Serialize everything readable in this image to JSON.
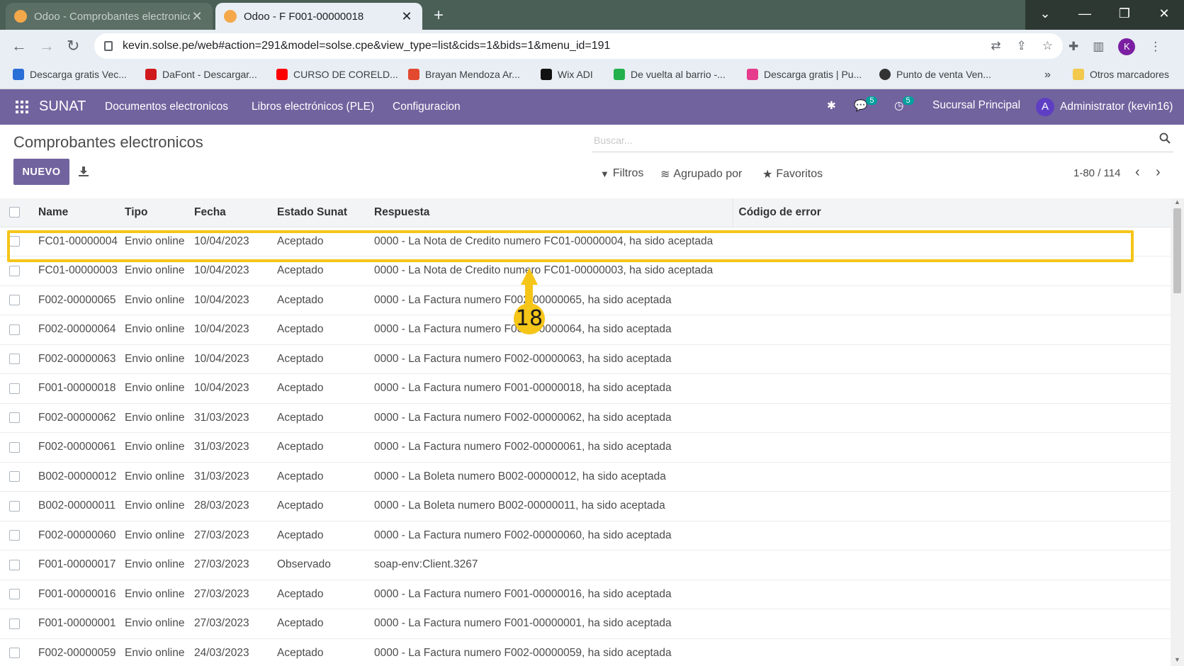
{
  "browser": {
    "tabs": [
      {
        "title": "Odoo - Comprobantes electronicos"
      },
      {
        "title": "Odoo - F F001-00000018"
      }
    ],
    "url": "kevin.solse.pe/web#action=291&model=solse.cpe&view_type=list&cids=1&bids=1&menu_id=191",
    "profile_initial": "K",
    "bookmarks": [
      {
        "label": "Descarga gratis Vec...",
        "color": "#2a6ed8"
      },
      {
        "label": "DaFont - Descargar...",
        "color": "#d0191d"
      },
      {
        "label": "CURSO DE CORELD...",
        "color": "#ff0000"
      },
      {
        "label": "Brayan Mendoza Ar...",
        "color": "#e2492f"
      },
      {
        "label": "Wix ADI",
        "color": "#111111"
      },
      {
        "label": "De vuelta al barrio -...",
        "color": "#22b14c"
      },
      {
        "label": "Descarga gratis | Pu...",
        "color": "#e63a8c"
      },
      {
        "label": "Punto de venta Ven...",
        "color": "#333333"
      }
    ],
    "bookmarks_more": "»",
    "other_bookmarks": "Otros marcadores"
  },
  "nav": {
    "brand": "SUNAT",
    "menu": [
      "Documentos electronicos",
      "Libros electrónicos (PLE)",
      "Configuracion"
    ],
    "messages_count": "5",
    "activities_count": "5",
    "company": "Sucursal Principal",
    "user_initial": "A",
    "user": "Administrator (kevin16)"
  },
  "page": {
    "breadcrumb": "Comprobantes electronicos",
    "search_placeholder": "Buscar...",
    "new_button": "NUEVO",
    "filters": "Filtros",
    "group_by": "Agrupado por",
    "favorites": "Favoritos",
    "pager": "1-80 / 114"
  },
  "table": {
    "headers": {
      "name": "Name",
      "tipo": "Tipo",
      "fecha": "Fecha",
      "estado": "Estado Sunat",
      "respuesta": "Respuesta",
      "error": "Código de error"
    },
    "rows": [
      {
        "name": "FC01-00000004",
        "tipo": "Envio online",
        "fecha": "10/04/2023",
        "estado": "Aceptado",
        "respuesta": "0000 - La Nota de Credito numero FC01-00000004, ha sido aceptada",
        "error": ""
      },
      {
        "name": "FC01-00000003",
        "tipo": "Envio online",
        "fecha": "10/04/2023",
        "estado": "Aceptado",
        "respuesta": "0000 - La Nota de Credito numero FC01-00000003, ha sido aceptada",
        "error": ""
      },
      {
        "name": "F002-00000065",
        "tipo": "Envio online",
        "fecha": "10/04/2023",
        "estado": "Aceptado",
        "respuesta": "0000 - La Factura numero F002-00000065, ha sido aceptada",
        "error": ""
      },
      {
        "name": "F002-00000064",
        "tipo": "Envio online",
        "fecha": "10/04/2023",
        "estado": "Aceptado",
        "respuesta": "0000 - La Factura numero F002-00000064, ha sido aceptada",
        "error": ""
      },
      {
        "name": "F002-00000063",
        "tipo": "Envio online",
        "fecha": "10/04/2023",
        "estado": "Aceptado",
        "respuesta": "0000 - La Factura numero F002-00000063, ha sido aceptada",
        "error": ""
      },
      {
        "name": "F001-00000018",
        "tipo": "Envio online",
        "fecha": "10/04/2023",
        "estado": "Aceptado",
        "respuesta": "0000 - La Factura numero F001-00000018, ha sido aceptada",
        "error": ""
      },
      {
        "name": "F002-00000062",
        "tipo": "Envio online",
        "fecha": "31/03/2023",
        "estado": "Aceptado",
        "respuesta": "0000 - La Factura numero F002-00000062, ha sido aceptada",
        "error": ""
      },
      {
        "name": "F002-00000061",
        "tipo": "Envio online",
        "fecha": "31/03/2023",
        "estado": "Aceptado",
        "respuesta": "0000 - La Factura numero F002-00000061, ha sido aceptada",
        "error": ""
      },
      {
        "name": "B002-00000012",
        "tipo": "Envio online",
        "fecha": "31/03/2023",
        "estado": "Aceptado",
        "respuesta": "0000 - La Boleta numero B002-00000012, ha sido aceptada",
        "error": ""
      },
      {
        "name": "B002-00000011",
        "tipo": "Envio online",
        "fecha": "28/03/2023",
        "estado": "Aceptado",
        "respuesta": "0000 - La Boleta numero B002-00000011, ha sido aceptada",
        "error": ""
      },
      {
        "name": "F002-00000060",
        "tipo": "Envio online",
        "fecha": "27/03/2023",
        "estado": "Aceptado",
        "respuesta": "0000 - La Factura numero F002-00000060, ha sido aceptada",
        "error": ""
      },
      {
        "name": "F001-00000017",
        "tipo": "Envio online",
        "fecha": "27/03/2023",
        "estado": "Observado",
        "respuesta": "soap-env:Client.3267",
        "error": ""
      },
      {
        "name": "F001-00000016",
        "tipo": "Envio online",
        "fecha": "27/03/2023",
        "estado": "Aceptado",
        "respuesta": "0000 - La Factura numero F001-00000016, ha sido aceptada",
        "error": ""
      },
      {
        "name": "F001-00000001",
        "tipo": "Envio online",
        "fecha": "27/03/2023",
        "estado": "Aceptado",
        "respuesta": "0000 - La Factura numero F001-00000001, ha sido aceptada",
        "error": ""
      },
      {
        "name": "F002-00000059",
        "tipo": "Envio online",
        "fecha": "24/03/2023",
        "estado": "Aceptado",
        "respuesta": "0000 - La Factura numero F002-00000059, ha sido aceptada",
        "error": ""
      }
    ]
  },
  "annotation": {
    "step": "18",
    "color": "#f5c518"
  },
  "colors": {
    "odoo_primary": "#71639e",
    "tab_bar": "#4a5f55"
  }
}
